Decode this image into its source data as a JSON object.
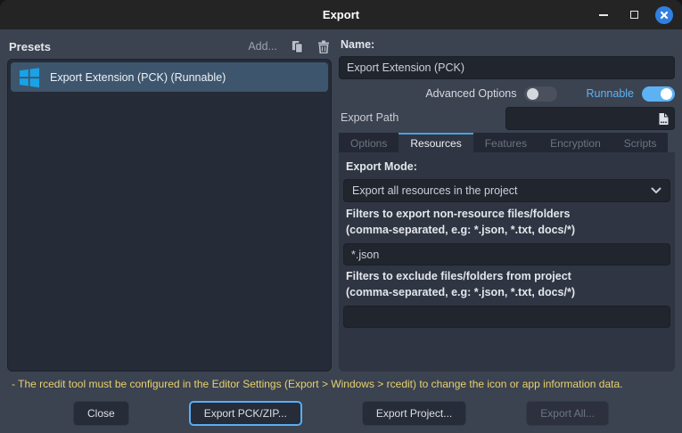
{
  "window": {
    "title": "Export"
  },
  "presets": {
    "header": "Presets",
    "add_label": "Add...",
    "items": [
      {
        "label": "Export Extension (PCK) (Runnable)",
        "platform_icon": "windows-logo",
        "selected": true
      }
    ]
  },
  "form": {
    "name_label": "Name:",
    "name_value": "Export Extension (PCK)",
    "advanced_options_label": "Advanced Options",
    "advanced_options_on": false,
    "runnable_label": "Runnable",
    "runnable_on": true,
    "export_path_label": "Export Path",
    "export_path_value": "",
    "tabs": [
      {
        "label": "Options",
        "active": false
      },
      {
        "label": "Resources",
        "active": true
      },
      {
        "label": "Features",
        "active": false
      },
      {
        "label": "Encryption",
        "active": false
      },
      {
        "label": "Scripts",
        "active": false
      }
    ],
    "resources_tab": {
      "export_mode_label": "Export Mode:",
      "export_mode_value": "Export all resources in the project",
      "include_filters_label": "Filters to export non-resource files/folders",
      "include_filters_hint": "(comma-separated, e.g: *.json, *.txt, docs/*)",
      "include_filters_value": "*.json",
      "exclude_filters_label": "Filters to exclude files/folders from project",
      "exclude_filters_hint": "(comma-separated, e.g: *.json, *.txt, docs/*)",
      "exclude_filters_value": ""
    }
  },
  "footer": {
    "warning": "- The rcedit tool must be configured in the Editor Settings (Export > Windows > rcedit) to change the icon or app information data.",
    "buttons": [
      {
        "label": "Close",
        "state": "normal"
      },
      {
        "label": "Export PCK/ZIP...",
        "state": "focused"
      },
      {
        "label": "Export Project...",
        "state": "normal"
      },
      {
        "label": "Export All...",
        "state": "disabled"
      }
    ]
  },
  "colors": {
    "titlebar_bg": "#242424",
    "dialog_bg": "#3b4250",
    "panel_bg": "#252b37",
    "tab_panel_bg": "#2f3542",
    "input_bg": "#20252e",
    "selected_row_bg": "#3d566e",
    "accent_blue": "#5cb2f2",
    "tab_accent": "#4aa0e0",
    "close_button_blue": "#3080e0",
    "windows_logo_blue": "#19a2e6",
    "warning_yellow": "#e6d16f"
  }
}
